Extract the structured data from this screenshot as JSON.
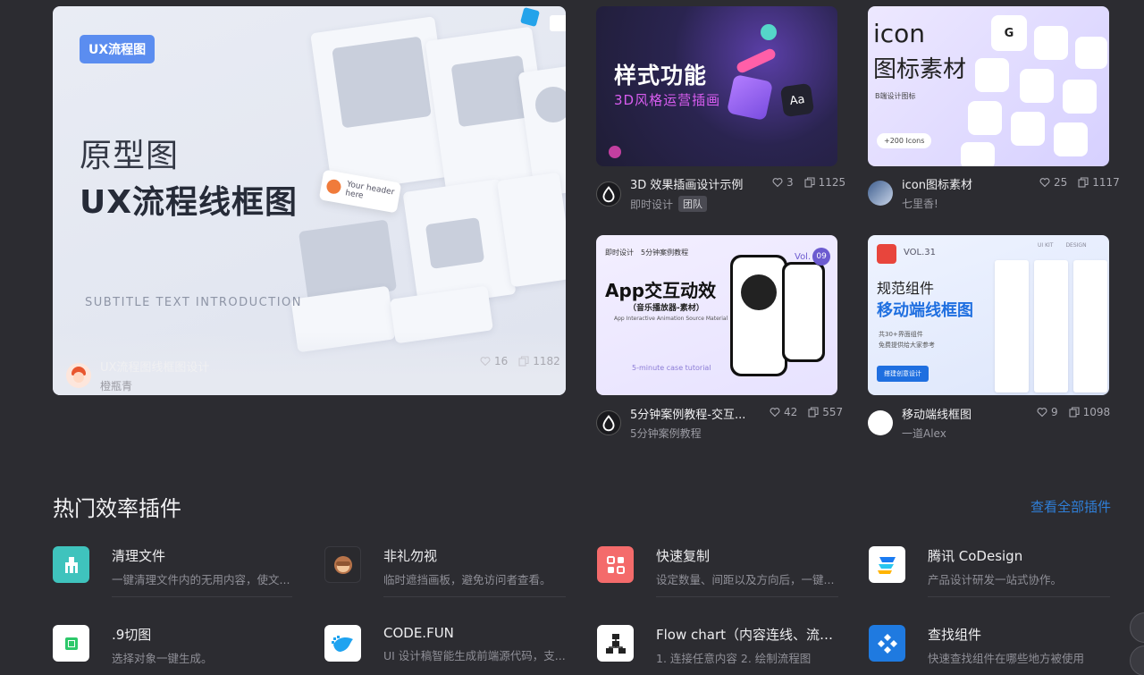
{
  "cards": [
    {
      "title": "UX流程图线框图设计",
      "author": "橙瓶青",
      "likes": "16",
      "copies": "1182",
      "thumb": {
        "tag": "UX流程图",
        "line1": "原型图",
        "line2": "UX流程线框图",
        "intro": "SUBTITLE TEXT INTRODUCTION",
        "pill": "Your header here"
      }
    },
    {
      "title": "3D 效果插画设计示例",
      "author": "即时设计",
      "badge": "团队",
      "likes": "3",
      "copies": "1125",
      "thumb": {
        "line1": "样式功能",
        "line2": "3D风格运营插画"
      }
    },
    {
      "title": "icon图标素材",
      "author": "七里香!",
      "likes": "25",
      "copies": "1117",
      "thumb": {
        "line1": "icon",
        "line2": "图标素材",
        "sub": "B端设计图标",
        "pill": "+200 Icons"
      }
    },
    {
      "title": "5分钟案例教程-交互...",
      "author": "5分钟案例教程",
      "likes": "42",
      "copies": "557",
      "thumb": {
        "brand": "即时设计",
        "series": "5分钟案例教程",
        "line1": "App交互动效",
        "line2": "（音乐播放器-素材）",
        "vol": "09",
        "vol_prefix": "Vol.",
        "en": "App Interactive Animation Source Material",
        "tutorial": "5-minute case tutorial"
      }
    },
    {
      "title": "移动端线框图",
      "author": "一道Alex",
      "likes": "9",
      "copies": "1098",
      "thumb": {
        "vol": "VOL.31",
        "line1": "规范组件",
        "line2": "移动端线框图",
        "bullet1": "共30+界面组件",
        "bullet2": "免费提供给大家参考",
        "button": "搭建创意设计",
        "top1": "UI KIT",
        "top2": "DESIGN"
      }
    }
  ],
  "section": {
    "title": "热门效率插件",
    "link": "查看全部插件"
  },
  "plugins": [
    {
      "name": "清理文件",
      "desc": "一键清理文件内的无用内容，使文...",
      "icon": "broom-icon",
      "color": "#3fc3bd"
    },
    {
      "name": "非礼勿视",
      "desc": "临时遮挡画板，避免访问者查看。",
      "icon": "monkey-icon",
      "color": "#2a2a2e"
    },
    {
      "name": "快速复制",
      "desc": "设定数量、间距以及方向后，一键...",
      "icon": "copy-grid-icon",
      "color": "#f46b6b"
    },
    {
      "name": "腾讯 CoDesign",
      "desc": "产品设计研发一站式协作。",
      "icon": "codesign-icon",
      "color": "#ffffff"
    },
    {
      "name": ".9切图",
      "desc": "选择对象一键生成。",
      "icon": "nine-patch-icon",
      "color": "#ffffff"
    },
    {
      "name": "CODE.FUN",
      "desc": "UI 设计稿智能生成前端源代码，支...",
      "icon": "bird-icon",
      "color": "#ffffff"
    },
    {
      "name": "Flow chart（内容连线、流程...",
      "desc": "1. 连接任意内容 2. 绘制流程图",
      "icon": "flowchart-icon",
      "color": "#ffffff"
    },
    {
      "name": "查找组件",
      "desc": "快速查找组件在哪些地方被使用",
      "icon": "find-component-icon",
      "color": "#1f7ae0"
    }
  ]
}
